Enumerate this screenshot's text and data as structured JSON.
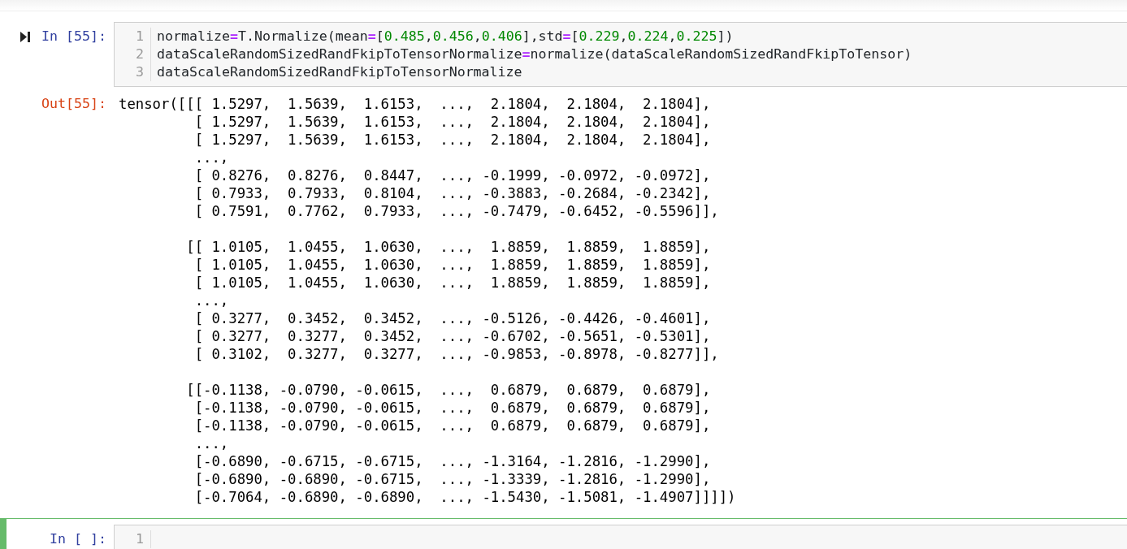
{
  "cells": [
    {
      "prompt": "In [55]:",
      "selected": false,
      "show_run_icon": true,
      "lines": [
        {
          "number": "1",
          "tokens": [
            {
              "kind": "plain",
              "text": "normalize"
            },
            {
              "kind": "op",
              "text": "="
            },
            {
              "kind": "plain",
              "text": "T.Normalize(mean"
            },
            {
              "kind": "op",
              "text": "="
            },
            {
              "kind": "plain",
              "text": "["
            },
            {
              "kind": "num",
              "text": "0.485"
            },
            {
              "kind": "plain",
              "text": ","
            },
            {
              "kind": "num",
              "text": "0.456"
            },
            {
              "kind": "plain",
              "text": ","
            },
            {
              "kind": "num",
              "text": "0.406"
            },
            {
              "kind": "plain",
              "text": "],std"
            },
            {
              "kind": "op",
              "text": "="
            },
            {
              "kind": "plain",
              "text": "["
            },
            {
              "kind": "num",
              "text": "0.229"
            },
            {
              "kind": "plain",
              "text": ","
            },
            {
              "kind": "num",
              "text": "0.224"
            },
            {
              "kind": "plain",
              "text": ","
            },
            {
              "kind": "num",
              "text": "0.225"
            },
            {
              "kind": "plain",
              "text": "])"
            }
          ]
        },
        {
          "number": "2",
          "tokens": [
            {
              "kind": "plain",
              "text": "dataScaleRandomSizedRandFkipToTensorNormalize"
            },
            {
              "kind": "op",
              "text": "="
            },
            {
              "kind": "plain",
              "text": "normalize(dataScaleRandomSizedRandFkipToTensor)"
            }
          ]
        },
        {
          "number": "3",
          "tokens": [
            {
              "kind": "plain",
              "text": "dataScaleRandomSizedRandFkipToTensorNormalize"
            }
          ]
        }
      ],
      "output": {
        "prompt": "Out[55]:",
        "blocks": [
          [
            "tensor([[[ 1.5297,  1.5639,  1.6153,  ...,  2.1804,  2.1804,  2.1804],",
            "         [ 1.5297,  1.5639,  1.6153,  ...,  2.1804,  2.1804,  2.1804],",
            "         [ 1.5297,  1.5639,  1.6153,  ...,  2.1804,  2.1804,  2.1804],",
            "         ...,",
            "         [ 0.8276,  0.8276,  0.8447,  ..., -0.1999, -0.0972, -0.0972],",
            "         [ 0.7933,  0.7933,  0.8104,  ..., -0.3883, -0.2684, -0.2342],",
            "         [ 0.7591,  0.7762,  0.7933,  ..., -0.7479, -0.6452, -0.5596]],"
          ],
          [
            "        [[ 1.0105,  1.0455,  1.0630,  ...,  1.8859,  1.8859,  1.8859],",
            "         [ 1.0105,  1.0455,  1.0630,  ...,  1.8859,  1.8859,  1.8859],",
            "         [ 1.0105,  1.0455,  1.0630,  ...,  1.8859,  1.8859,  1.8859],",
            "         ...,",
            "         [ 0.3277,  0.3452,  0.3452,  ..., -0.5126, -0.4426, -0.4601],",
            "         [ 0.3277,  0.3277,  0.3452,  ..., -0.6702, -0.5651, -0.5301],",
            "         [ 0.3102,  0.3277,  0.3277,  ..., -0.9853, -0.8978, -0.8277]],"
          ],
          [
            "        [[-0.1138, -0.0790, -0.0615,  ...,  0.6879,  0.6879,  0.6879],",
            "         [-0.1138, -0.0790, -0.0615,  ...,  0.6879,  0.6879,  0.6879],",
            "         [-0.1138, -0.0790, -0.0615,  ...,  0.6879,  0.6879,  0.6879],",
            "         ...,",
            "         [-0.6890, -0.6715, -0.6715,  ..., -1.3164, -1.2816, -1.2990],",
            "         [-0.6890, -0.6890, -0.6715,  ..., -1.3339, -1.2816, -1.2990],",
            "         [-0.7064, -0.6890, -0.6890,  ..., -1.5430, -1.5081, -1.4907]]]])"
          ]
        ]
      }
    },
    {
      "prompt": "In [ ]:",
      "selected": true,
      "show_run_icon": false,
      "lines": [
        {
          "number": "1"
        }
      ]
    }
  ]
}
